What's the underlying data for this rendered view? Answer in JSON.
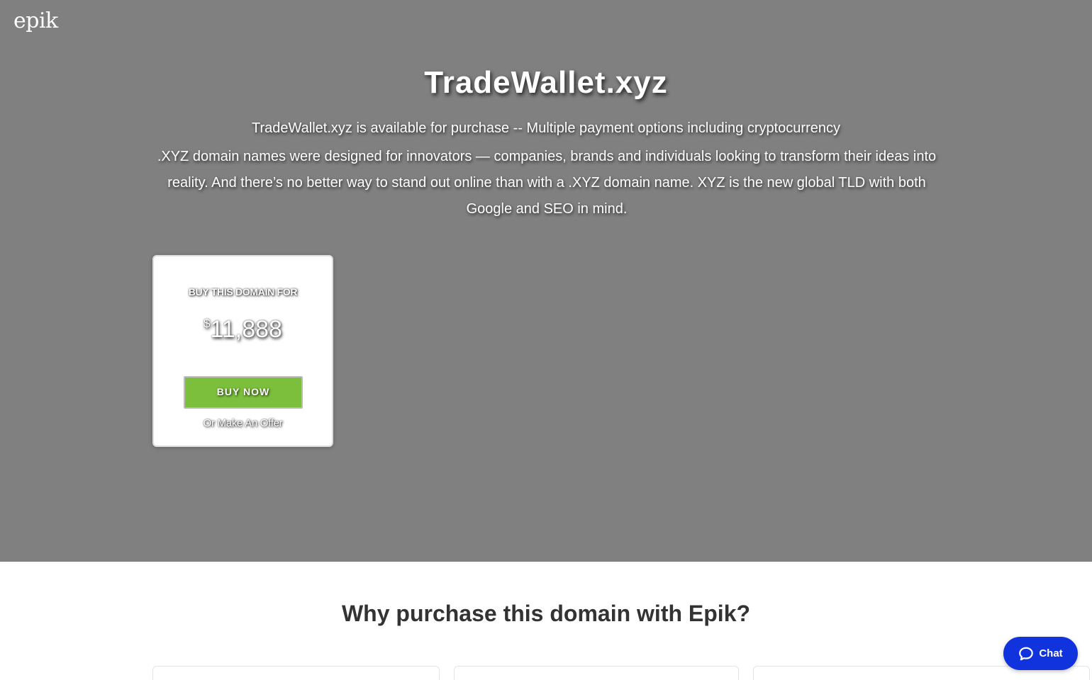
{
  "header": {
    "logo_text": "epik"
  },
  "hero": {
    "domain_title": "TradeWallet.xyz",
    "tagline": "TradeWallet.xyz is available for purchase -- Multiple payment options including cryptocurrency",
    "description": ".XYZ domain names were designed for innovators — companies, brands and individuals looking to transform their ideas into reality. And there’s no better way to stand out online than with a .XYZ domain name. XYZ is the new global TLD with both Google and SEO in mind.",
    "background_color": "#808080"
  },
  "buy_card": {
    "label": "BUY THIS DOMAIN FOR",
    "currency_symbol": "$",
    "price": "11,888",
    "buy_button_label": "BUY NOW",
    "buy_button_color": "#7cbf3c",
    "offer_link_label": "Or Make An Offer"
  },
  "why_section": {
    "heading": "Why purchase this domain with Epik?"
  },
  "chat": {
    "label": "Chat",
    "icon": "chat-bubble-icon",
    "color": "#1133dd"
  }
}
